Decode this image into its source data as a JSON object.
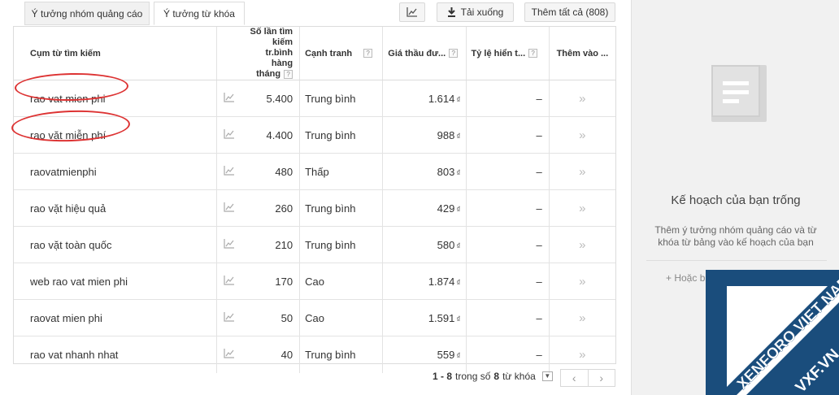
{
  "tabs": [
    {
      "label": "Ý tưởng nhóm quảng cáo"
    },
    {
      "label": "Ý tưởng từ khóa"
    }
  ],
  "toolbar": {
    "download_label": "Tải xuống",
    "add_all_label": "Thêm tất cả (808)"
  },
  "table": {
    "headers": {
      "keyword": "Cụm từ tìm kiếm",
      "searches_line1": "Số lần tìm kiếm",
      "searches_line2": "tr.bình hàng",
      "searches_line3": "tháng",
      "competition": "Cạnh tranh",
      "bid": "Giá thầu đư...",
      "impression": "Tỷ lệ hiển t...",
      "add": "Thêm vào ..."
    },
    "help_label": "?",
    "currency": "₫",
    "rows": [
      {
        "keyword": "rao vat mien phi",
        "searches": "5.400",
        "competition": "Trung bình",
        "bid": "1.614",
        "impression": "–"
      },
      {
        "keyword": "rao vặt miễn phí",
        "searches": "4.400",
        "competition": "Trung bình",
        "bid": "988",
        "impression": "–"
      },
      {
        "keyword": "raovatmienphi",
        "searches": "480",
        "competition": "Thấp",
        "bid": "803",
        "impression": "–"
      },
      {
        "keyword": "rao vặt hiệu quả",
        "searches": "260",
        "competition": "Trung bình",
        "bid": "429",
        "impression": "–"
      },
      {
        "keyword": "rao vặt toàn quốc",
        "searches": "210",
        "competition": "Trung bình",
        "bid": "580",
        "impression": "–"
      },
      {
        "keyword": "web rao vat mien phi",
        "searches": "170",
        "competition": "Cao",
        "bid": "1.874",
        "impression": "–"
      },
      {
        "keyword": "raovat mien phi",
        "searches": "50",
        "competition": "Cao",
        "bid": "1.591",
        "impression": "–"
      },
      {
        "keyword": "rao vat nhanh nhat",
        "searches": "40",
        "competition": "Trung bình",
        "bid": "559",
        "impression": "–"
      }
    ]
  },
  "pagination": {
    "range": "1 - 8",
    "of_text": "trong số",
    "total": "8",
    "unit_text": "từ khóa"
  },
  "plan_panel": {
    "title": "Kế hoạch của bạn trống",
    "description": "Thêm ý tưởng nhóm quảng cáo và từ khóa từ bảng vào kế hoạch của bạn",
    "or_text": "+ Hoặc b"
  },
  "watermark": {
    "line1": "XENFORO VIET NAM",
    "line2": "VXF.VN"
  },
  "colors": {
    "annotation": "#d33333",
    "watermark_bg": "#1a4d7c"
  }
}
